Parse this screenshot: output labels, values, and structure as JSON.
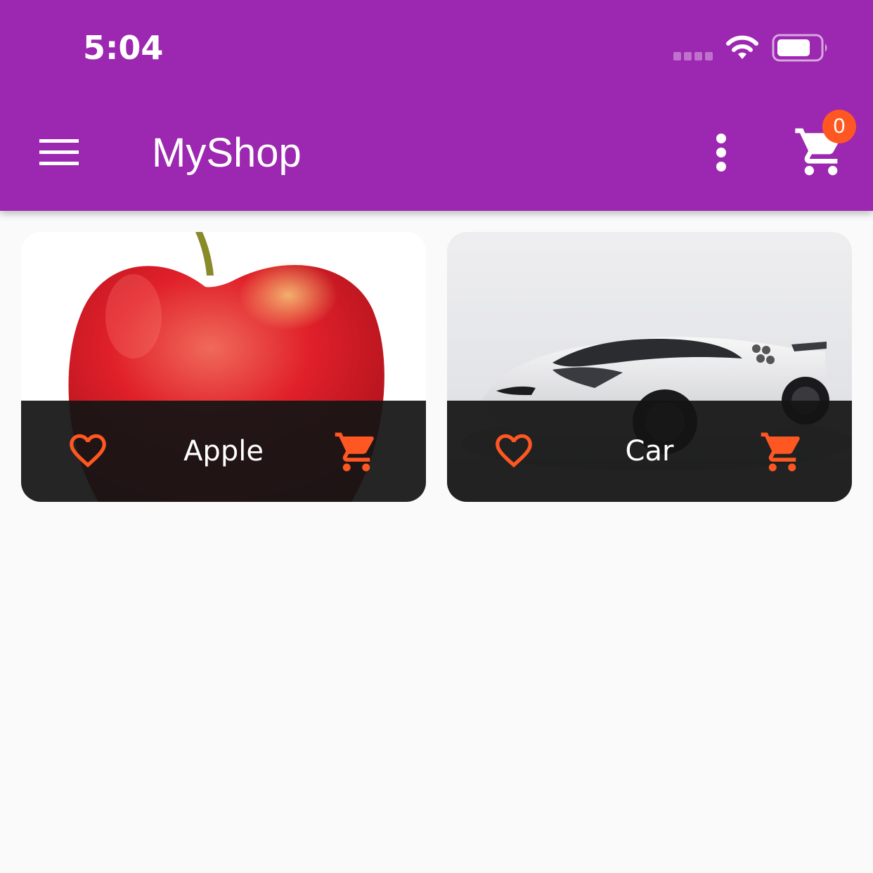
{
  "status_bar": {
    "time": "5:04",
    "signal_icon": "signal-icon",
    "wifi_icon": "wifi-icon",
    "battery_icon": "battery-icon"
  },
  "app_bar": {
    "title": "MyShop",
    "menu_icon": "menu-icon",
    "more_icon": "more-vertical-icon",
    "cart_icon": "cart-icon",
    "cart_count": "0"
  },
  "products": [
    {
      "title": "Apple",
      "favorite_icon": "heart-outline-icon",
      "cart_icon": "add-to-cart-icon"
    },
    {
      "title": "Car",
      "favorite_icon": "heart-outline-icon",
      "cart_icon": "add-to-cart-icon"
    }
  ],
  "colors": {
    "primary": "#9c27b0",
    "accent": "#ff5722",
    "background": "#fafafa",
    "footer": "#1e1e1e"
  }
}
